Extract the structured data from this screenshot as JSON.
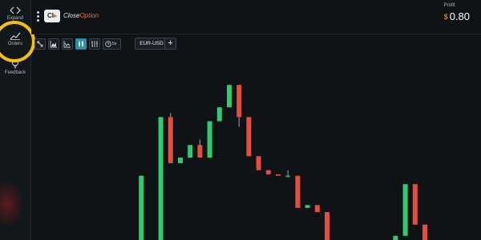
{
  "sidebar": {
    "items": [
      {
        "label": "Expand",
        "icon": "code-brackets-icon"
      },
      {
        "label": "Orders",
        "icon": "trend-line-icon"
      },
      {
        "label": "Feedback",
        "icon": "lightbulb-icon"
      }
    ],
    "highlight_color": "#f2c10c"
  },
  "header": {
    "logo_badge": "CI",
    "logo_word_1": "Close",
    "logo_word_2": "Option",
    "profit_label": "Profit",
    "profit_currency": "$",
    "profit_value": "0.80"
  },
  "toolbar": {
    "buttons": [
      {
        "icon": "fullscreen-icon",
        "active": false
      },
      {
        "icon": "area-chart-icon",
        "active": false
      },
      {
        "icon": "line-chart-icon",
        "active": false
      },
      {
        "icon": "candlestick-icon",
        "active": true
      },
      {
        "icon": "bar-chart-icon",
        "active": false
      }
    ],
    "timeframe": "5s",
    "pair": "EUR-USD",
    "add_label": "+"
  },
  "colors": {
    "up": "#2ecc71",
    "down": "#e74c3c",
    "background": "#0f1316"
  },
  "chart_data": {
    "type": "candlestick",
    "candles": [
      {
        "o": 1.6,
        "h": 1.8,
        "l": 0.0,
        "c": 0.0
      },
      {
        "o": 0.0,
        "h": 4.6,
        "l": 0.0,
        "c": 4.6
      },
      {
        "o": 0.0,
        "h": 8.8,
        "l": 0.0,
        "c": 8.8
      },
      {
        "o": 8.8,
        "h": 9.1,
        "l": 5.5,
        "c": 5.5
      },
      {
        "o": 5.5,
        "h": 5.9,
        "l": 5.5,
        "c": 5.9
      },
      {
        "o": 5.9,
        "h": 6.8,
        "l": 5.9,
        "c": 6.8
      },
      {
        "o": 6.8,
        "h": 7.2,
        "l": 5.9,
        "c": 5.9
      },
      {
        "o": 5.9,
        "h": 8.5,
        "l": 5.9,
        "c": 8.5
      },
      {
        "o": 8.5,
        "h": 9.5,
        "l": 8.5,
        "c": 9.5
      },
      {
        "o": 9.5,
        "h": 11.1,
        "l": 9.5,
        "c": 11.1
      },
      {
        "o": 11.1,
        "h": 11.1,
        "l": 8.1,
        "c": 8.8
      },
      {
        "o": 8.8,
        "h": 8.8,
        "l": 6.0,
        "c": 6.0
      },
      {
        "o": 6.0,
        "h": 6.0,
        "l": 5.0,
        "c": 5.0
      },
      {
        "o": 5.0,
        "h": 5.0,
        "l": 4.7,
        "c": 4.7
      },
      {
        "o": 4.7,
        "h": 4.7,
        "l": 4.6,
        "c": 4.6
      },
      {
        "o": 4.6,
        "h": 5.0,
        "l": 4.5,
        "c": 4.6
      },
      {
        "o": 4.6,
        "h": 4.6,
        "l": 2.3,
        "c": 2.3
      },
      {
        "o": 2.3,
        "h": 2.5,
        "l": 2.3,
        "c": 2.5
      },
      {
        "o": 2.5,
        "h": 2.5,
        "l": 2.0,
        "c": 2.0
      },
      {
        "o": 2.0,
        "h": 2.0,
        "l": 0.0,
        "c": 0.0
      },
      {
        "o": 0.0,
        "h": 0.3,
        "l": 0.0,
        "c": 0.3
      },
      {
        "o": 0.3,
        "h": 4.0,
        "l": 0.3,
        "c": 4.0
      },
      {
        "o": 4.0,
        "h": 4.0,
        "l": 1.1,
        "c": 1.1
      },
      {
        "o": 1.1,
        "h": 1.1,
        "l": 0.0,
        "c": 0.0
      }
    ],
    "slots": [
      -2,
      11,
      13,
      14,
      15,
      16,
      17,
      18,
      19,
      20,
      21,
      22,
      23,
      24,
      25,
      26,
      27,
      28,
      29,
      30,
      37,
      38,
      39,
      40
    ],
    "ylim": [
      0,
      13.4
    ],
    "grid": false
  }
}
